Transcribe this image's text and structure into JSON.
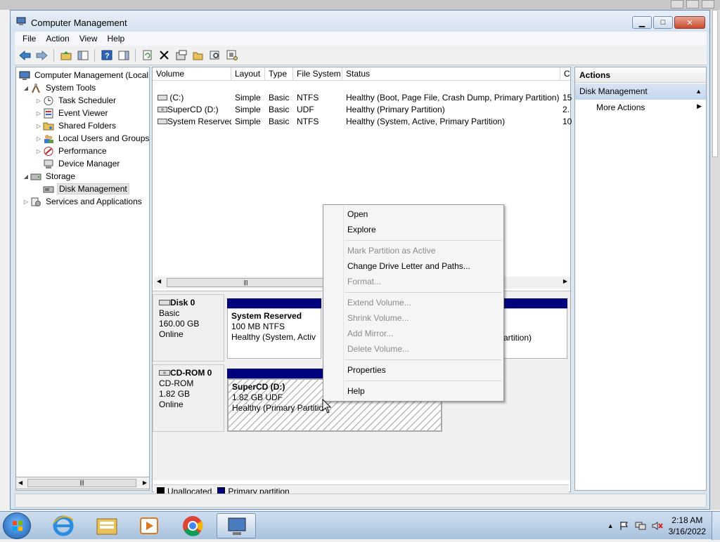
{
  "window": {
    "title": "Computer Management",
    "min": "▁",
    "max": "□",
    "close": "✕"
  },
  "menu": [
    "File",
    "Action",
    "View",
    "Help"
  ],
  "tree": {
    "root": "Computer Management (Local",
    "system_tools": "System Tools",
    "task_scheduler": "Task Scheduler",
    "event_viewer": "Event Viewer",
    "shared_folders": "Shared Folders",
    "local_users": "Local Users and Groups",
    "performance": "Performance",
    "device_manager": "Device Manager",
    "storage": "Storage",
    "disk_management": "Disk Management",
    "services": "Services and Applications"
  },
  "volumes": {
    "headers": [
      "Volume",
      "Layout",
      "Type",
      "File System",
      "Status",
      "C"
    ],
    "rows": [
      [
        "(C:)",
        "Simple",
        "Basic",
        "NTFS",
        "Healthy (Boot, Page File, Crash Dump, Primary Partition)",
        "15"
      ],
      [
        "SuperCD (D:)",
        "Simple",
        "Basic",
        "UDF",
        "Healthy (Primary Partition)",
        "2."
      ],
      [
        "System Reserved",
        "Simple",
        "Basic",
        "NTFS",
        "Healthy (System, Active, Primary Partition)",
        "10"
      ]
    ]
  },
  "disks": {
    "disk0": {
      "name": "Disk 0",
      "type": "Basic",
      "size": "160.00 GB",
      "state": "Online"
    },
    "disk0_part": {
      "name": "System Reserved",
      "size": "100 MB NTFS",
      "status": "Healthy (System, Activ"
    },
    "disk0_part2_tail": "artition)",
    "cdrom": {
      "name": "CD-ROM 0",
      "type": "CD-ROM",
      "size": "1.82 GB",
      "state": "Online"
    },
    "cdrom_part": {
      "name": "SuperCD  (D:)",
      "size": "1.82 GB UDF",
      "status": "Healthy (Primary Partitio"
    }
  },
  "legend": {
    "unallocated": "Unallocated",
    "primary": "Primary partition",
    "unallocated_color": "#000000",
    "primary_color": "#00007f"
  },
  "actions": {
    "header": "Actions",
    "section": "Disk Management",
    "more": "More Actions"
  },
  "context_menu": {
    "open": "Open",
    "explore": "Explore",
    "mark_active": "Mark Partition as Active",
    "change_letter": "Change Drive Letter and Paths...",
    "format": "Format...",
    "extend": "Extend Volume...",
    "shrink": "Shrink Volume...",
    "add_mirror": "Add Mirror...",
    "delete": "Delete Volume...",
    "properties": "Properties",
    "help": "Help"
  },
  "taskbar": {
    "time": "2:18 AM",
    "date": "3/16/2022"
  }
}
